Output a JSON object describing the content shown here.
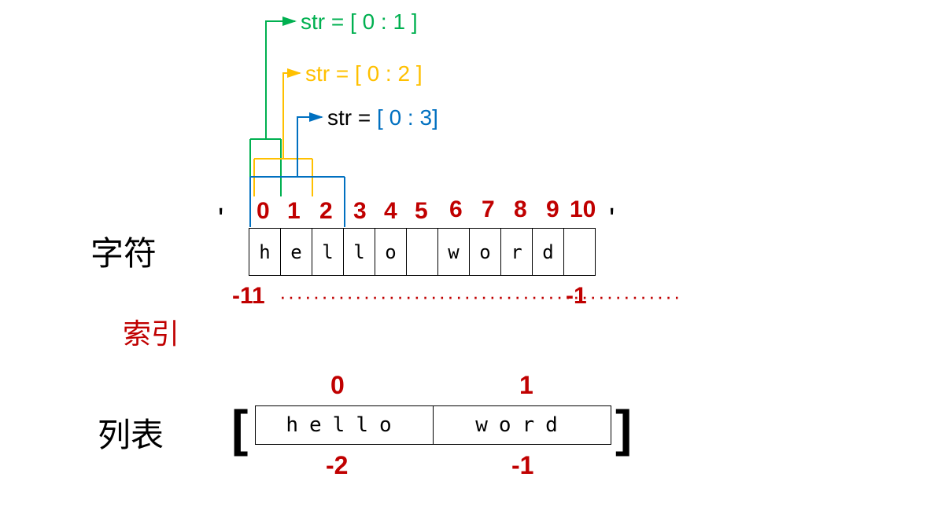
{
  "labels": {
    "string": "字符",
    "index": "索引",
    "list": "列表"
  },
  "quotes": {
    "left": "'",
    "right": "'"
  },
  "brackets": {
    "left": "[",
    "right": "]"
  },
  "string_chars": [
    "h",
    "e",
    "l",
    "l",
    "o",
    " ",
    "w",
    "o",
    "r",
    "d",
    " "
  ],
  "positive_indices": [
    "0",
    "1",
    "2",
    "3",
    "4",
    "5",
    "6",
    "7",
    "8",
    "9",
    "10"
  ],
  "negative_indices": {
    "left": "-11",
    "right": "-1",
    "dots": "················································"
  },
  "list_items": [
    "hello",
    "word"
  ],
  "list_pos_idx": [
    "0",
    "1"
  ],
  "list_neg_idx": [
    "-2",
    "-1"
  ],
  "slices": {
    "green": {
      "prefix": "str = [ ",
      "start": "0",
      "colon": " : ",
      "end": "1",
      "suffix": " ]"
    },
    "orange": {
      "prefix": "str = [ ",
      "start": "0",
      "colon": " : ",
      "end": "2",
      "suffix": " ]"
    },
    "blue": {
      "prefix": "str = ",
      "lb": "[ ",
      "start": "0",
      "colon": " : ",
      "end": "3",
      "rb": "]"
    }
  }
}
